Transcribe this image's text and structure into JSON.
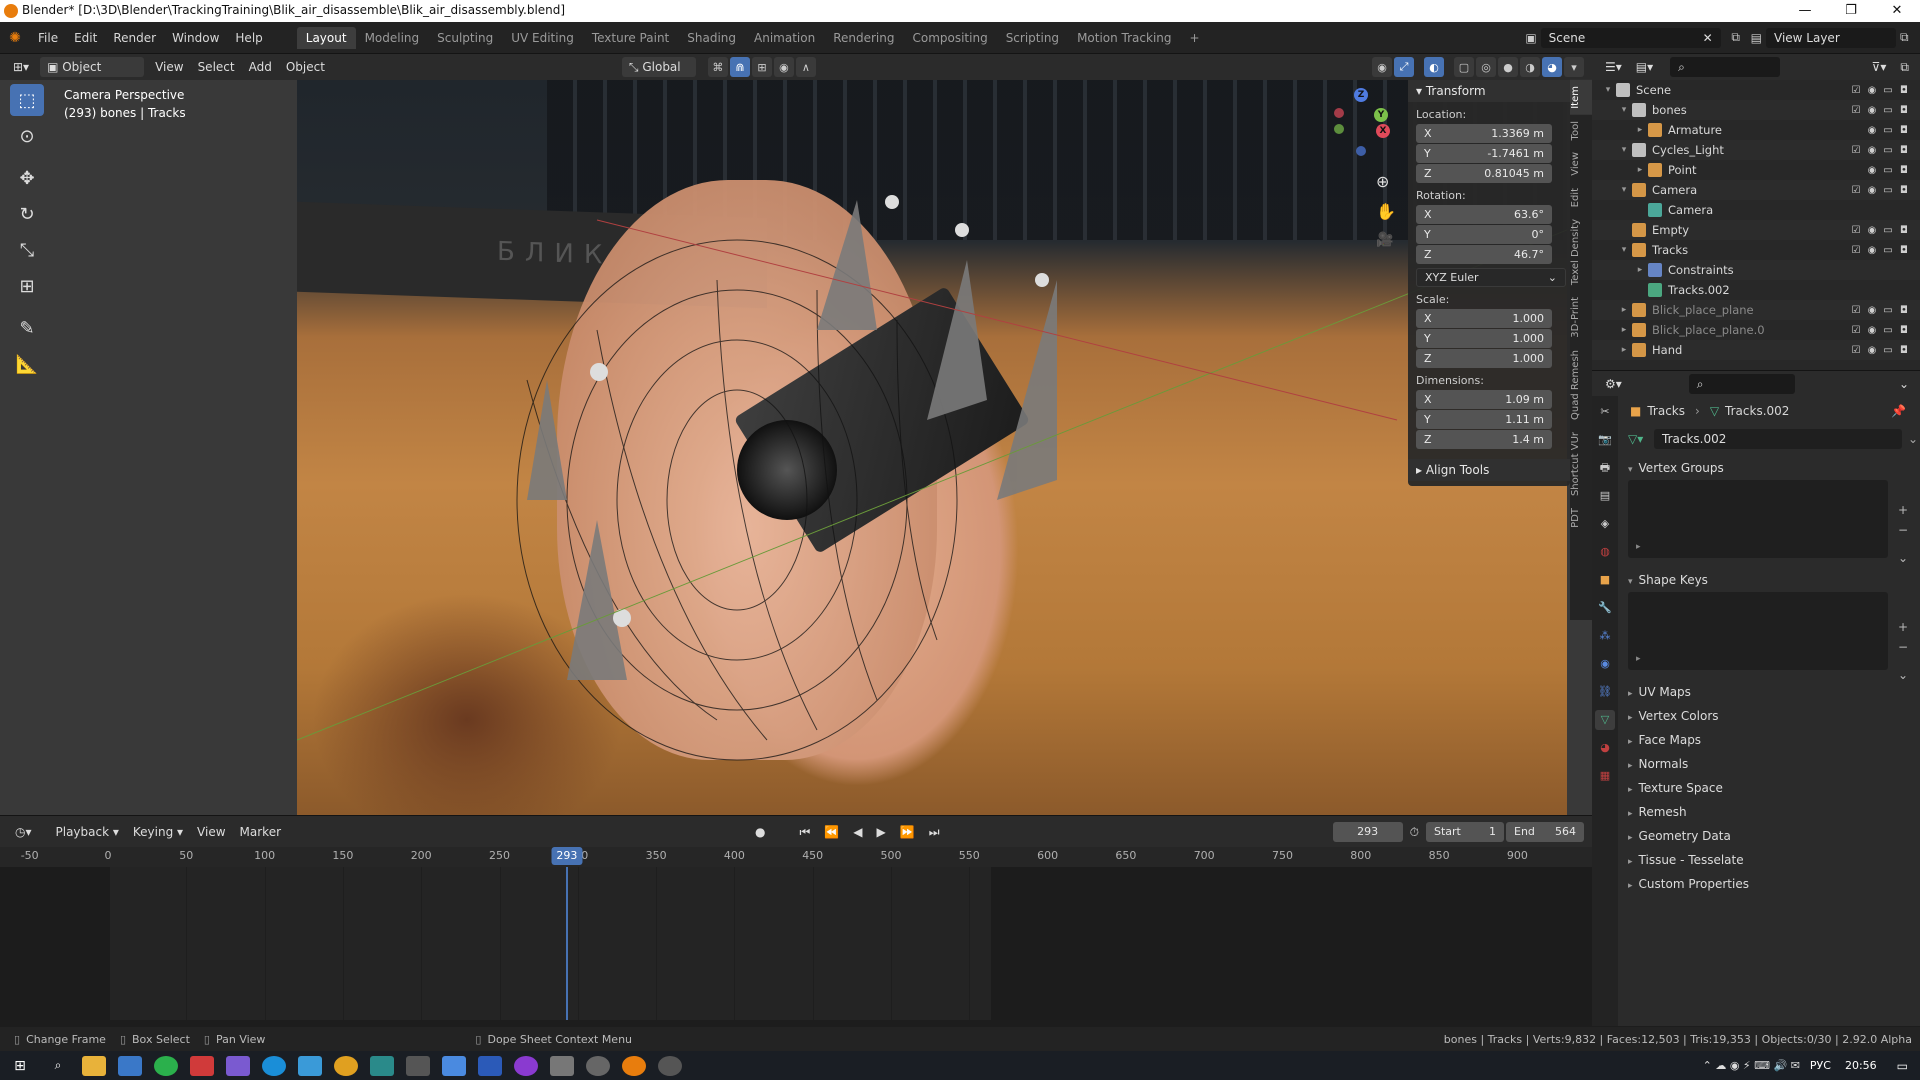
{
  "window": {
    "title": "Blender* [D:\\3D\\Blender\\TrackingTraining\\Blik_air_disassemble\\Blik_air_disassembly.blend]",
    "controls": [
      "—",
      "❐",
      "✕"
    ]
  },
  "menu": [
    "File",
    "Edit",
    "Render",
    "Window",
    "Help"
  ],
  "workspaces": [
    {
      "label": "Layout",
      "active": true
    },
    {
      "label": "Modeling"
    },
    {
      "label": "Sculpting"
    },
    {
      "label": "UV Editing"
    },
    {
      "label": "Texture Paint"
    },
    {
      "label": "Shading"
    },
    {
      "label": "Animation"
    },
    {
      "label": "Rendering"
    },
    {
      "label": "Compositing"
    },
    {
      "label": "Scripting"
    },
    {
      "label": "Motion Tracking"
    }
  ],
  "scene_selector": {
    "value": "Scene"
  },
  "view_layer": {
    "value": "View Layer"
  },
  "viewport_header": {
    "mode": "Object Mode",
    "menus": [
      "View",
      "Select",
      "Add",
      "Object"
    ],
    "transform_orientation": "Global"
  },
  "viewport": {
    "overlay_line1": "Camera Perspective",
    "overlay_line2": "(293) bones | Tracks",
    "photo_text": "БЛИК",
    "gizmo": {
      "x": "X",
      "y": "Y",
      "z": "Z"
    }
  },
  "npanel": {
    "header": "Transform",
    "location_label": "Location:",
    "location": [
      {
        "axis": "X",
        "value": "1.3369 m"
      },
      {
        "axis": "Y",
        "value": "-1.7461 m"
      },
      {
        "axis": "Z",
        "value": "0.81045 m"
      }
    ],
    "rotation_label": "Rotation:",
    "rotation": [
      {
        "axis": "X",
        "value": "63.6°"
      },
      {
        "axis": "Y",
        "value": "0°"
      },
      {
        "axis": "Z",
        "value": "46.7°"
      }
    ],
    "rotation_mode": "XYZ Euler",
    "scale_label": "Scale:",
    "scale": [
      {
        "axis": "X",
        "value": "1.000"
      },
      {
        "axis": "Y",
        "value": "1.000"
      },
      {
        "axis": "Z",
        "value": "1.000"
      }
    ],
    "dimensions_label": "Dimensions:",
    "dimensions": [
      {
        "axis": "X",
        "value": "1.09 m"
      },
      {
        "axis": "Y",
        "value": "1.11 m"
      },
      {
        "axis": "Z",
        "value": "1.4 m"
      }
    ],
    "align_tools": "Align Tools",
    "tabs": [
      "Item",
      "Tool",
      "View",
      "Edit",
      "Texel Density",
      "3D-Print",
      "Quad Remesh",
      "Shortcut VUr",
      "PDT"
    ]
  },
  "outliner": {
    "rows": [
      {
        "name": "Scene",
        "indent": 0,
        "icon": "scene-icon",
        "color": "#cfcfcf",
        "expand": "▾"
      },
      {
        "name": "bones",
        "indent": 1,
        "icon": "collection-icon",
        "color": "#cfcfcf",
        "expand": "▾"
      },
      {
        "name": "Armature",
        "indent": 2,
        "icon": "armature-icon",
        "color": "#e8a34a",
        "expand": "▸"
      },
      {
        "name": "Cycles_Light",
        "indent": 1,
        "icon": "collection-icon",
        "color": "#cfcfcf",
        "expand": "▾"
      },
      {
        "name": "Point",
        "indent": 2,
        "icon": "light-icon",
        "color": "#e8a34a",
        "expand": "▸"
      },
      {
        "name": "Camera",
        "indent": 1,
        "icon": "camera-icon",
        "color": "#e8a34a",
        "expand": "▾"
      },
      {
        "name": "Camera",
        "indent": 2,
        "icon": "camera-data-icon",
        "color": "#4fb5a5",
        "expand": ""
      },
      {
        "name": "Empty",
        "indent": 1,
        "icon": "empty-icon",
        "color": "#e8a34a",
        "expand": ""
      },
      {
        "name": "Tracks",
        "indent": 1,
        "icon": "mesh-icon",
        "color": "#e8a34a",
        "expand": "▾"
      },
      {
        "name": "Constraints",
        "indent": 2,
        "icon": "constraint-icon",
        "color": "#6d8fd6",
        "expand": "▸"
      },
      {
        "name": "Tracks.002",
        "indent": 2,
        "icon": "mesh-data-icon",
        "color": "#4fb58a",
        "expand": ""
      },
      {
        "name": "Blick_place_plane",
        "indent": 1,
        "icon": "mesh-icon",
        "color": "#e8a34a",
        "expand": "▸",
        "dim": true
      },
      {
        "name": "Blick_place_plane.0",
        "indent": 1,
        "icon": "mesh-icon",
        "color": "#e8a34a",
        "expand": "▸",
        "dim": true
      },
      {
        "name": "Hand",
        "indent": 1,
        "icon": "mesh-icon",
        "color": "#e8a34a",
        "expand": "▸"
      }
    ]
  },
  "properties": {
    "object_name": "Tracks",
    "mesh_name": "Tracks.002",
    "datablock": "Tracks.002",
    "sections_open": [
      "Vertex Groups",
      "Shape Keys"
    ],
    "sections_closed": [
      "UV Maps",
      "Vertex Colors",
      "Face Maps",
      "Normals",
      "Texture Space",
      "Remesh",
      "Geometry Data",
      "Tissue - Tesselate",
      "Custom Properties"
    ]
  },
  "timeline": {
    "menus": [
      "Playback",
      "Keying",
      "View",
      "Marker"
    ],
    "current_frame": "293",
    "start_label": "Start",
    "start": "1",
    "end_label": "End",
    "end": "564",
    "ticks": [
      "-50",
      "0",
      "50",
      "100",
      "150",
      "200",
      "250",
      "300",
      "350",
      "400",
      "450",
      "500",
      "550",
      "600",
      "650",
      "700",
      "750",
      "800",
      "850",
      "900"
    ],
    "playhead": "293"
  },
  "statusbar": {
    "left": [
      "Change Frame",
      "Box Select",
      "Pan View",
      "Dope Sheet Context Menu"
    ],
    "right": "bones | Tracks | Verts:9,832 | Faces:12,503 | Tris:19,353 | Objects:0/30 | 2.92.0 Alpha"
  },
  "taskbar": {
    "lang": "РУС",
    "time": "20:56"
  },
  "colors": {
    "accent": "#4772b3",
    "orange": "#e87d0d"
  }
}
